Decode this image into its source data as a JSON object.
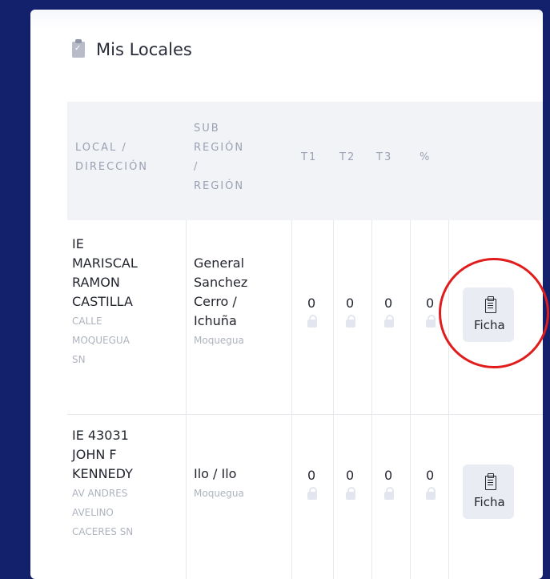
{
  "page": {
    "title": "Mis Locales",
    "title_icon": "clipboard-check-icon"
  },
  "table": {
    "headers": {
      "local_line1": "LOCAL /",
      "local_line2": "DIRECCIÓN",
      "sub_line1": "SUB",
      "sub_line2": "REGIÓN",
      "sub_line3": "/",
      "sub_line4": "REGIÓN",
      "t1": "T1",
      "t2": "T2",
      "t3": "T3",
      "pct": "%"
    },
    "rows": [
      {
        "local_lines": [
          "IE",
          "MARISCAL",
          "RAMON",
          "CASTILLA"
        ],
        "address_lines": [
          "CALLE",
          "MOQUEGUA",
          "SN"
        ],
        "subregion_lines": [
          "General",
          "Sanchez",
          "Cerro /",
          "Ichuña"
        ],
        "region": "Moquegua",
        "t1": "0",
        "t2": "0",
        "t3": "0",
        "pct": "0",
        "button": "Ficha"
      },
      {
        "local_lines": [
          "IE 43031",
          "JOHN F",
          "KENNEDY"
        ],
        "address_lines": [
          "AV ANDRES",
          "AVELINO",
          "CACERES SN"
        ],
        "subregion_lines": [
          "Ilo / Ilo"
        ],
        "region": "Moquegua",
        "t1": "0",
        "t2": "0",
        "t3": "0",
        "pct": "0",
        "button": "Ficha"
      }
    ]
  },
  "colors": {
    "background": "#13206b",
    "header_bg": "#f1f3f7",
    "highlight": "#e11c1c"
  }
}
